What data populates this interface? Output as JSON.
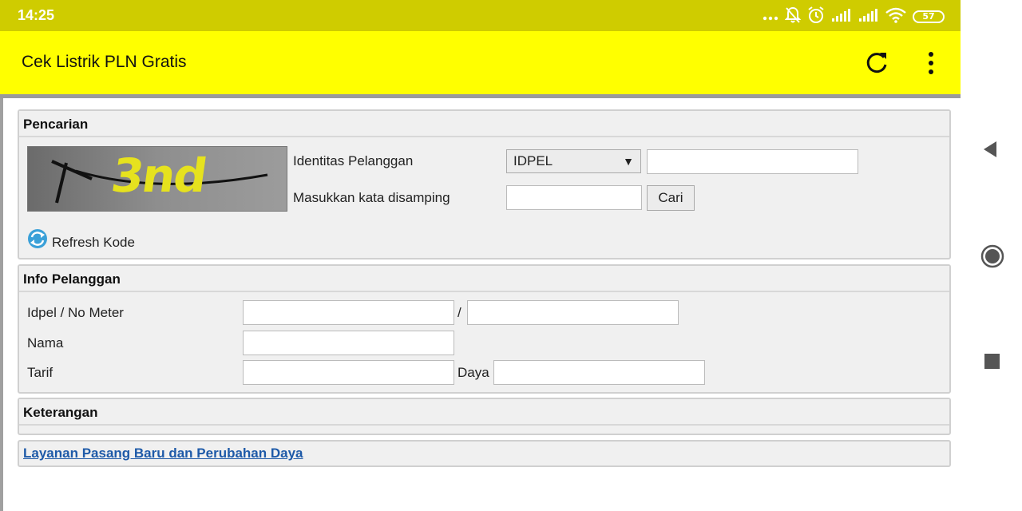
{
  "status": {
    "time": "14:25",
    "battery": "57"
  },
  "app": {
    "title": "Cek Listrik PLN Gratis"
  },
  "search_panel": {
    "heading": "Pencarian",
    "captcha_text": "3nd",
    "label_identity": "Identitas Pelanggan",
    "select_value": "IDPEL",
    "label_word": "Masukkan kata disamping",
    "search_button": "Cari",
    "refresh_code": "Refresh Kode"
  },
  "info_panel": {
    "heading": "Info Pelanggan",
    "label_idpel": "Idpel / No Meter",
    "separator": "/",
    "label_nama": "Nama",
    "label_tarif": "Tarif",
    "label_daya": "Daya"
  },
  "note_panel": {
    "heading": "Keterangan"
  },
  "link_panel": {
    "link_text": "Layanan Pasang Baru dan Perubahan Daya"
  },
  "colors": {
    "statusbar": "#cfcc00",
    "appbar": "#ffff00",
    "link": "#1e5aa8"
  }
}
